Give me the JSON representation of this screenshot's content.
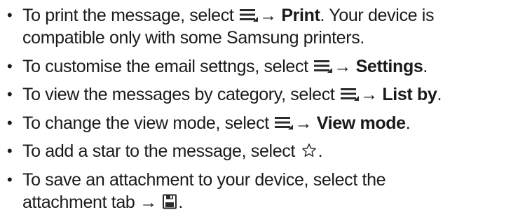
{
  "arrow": "→",
  "bullet": "•",
  "icons": {
    "menu": "menu-icon",
    "star": "star-outline-icon",
    "save": "save-floppy-icon"
  },
  "colors": {
    "text": "#1a1a1a",
    "icon": "#2b2b2b"
  },
  "items": [
    {
      "line1_pre": "To print the message, select ",
      "line1_bold": "Print",
      "line1_post": ". Your device is",
      "line2": "compatible only with some Samsung printers."
    },
    {
      "pre": "To customise the email settngs, select ",
      "bold": "Settings",
      "post": "."
    },
    {
      "pre": "To view the messages by category, select ",
      "bold": "List by",
      "post": "."
    },
    {
      "pre": "To change the view mode, select ",
      "bold": "View mode",
      "post": "."
    },
    {
      "pre": "To add a star to the message, select ",
      "post": "."
    },
    {
      "line1": "To save an attachment to your device, select the",
      "line2_pre": "attachment tab ",
      "line2_post": "."
    }
  ]
}
